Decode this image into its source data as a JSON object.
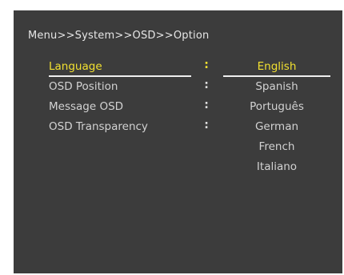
{
  "breadcrumb": "Menu>>System>>OSD>>Option",
  "menu_items": [
    {
      "label": "Language",
      "selected": true
    },
    {
      "label": "OSD Position",
      "selected": false
    },
    {
      "label": "Message OSD",
      "selected": false
    },
    {
      "label": "OSD Transparency",
      "selected": false
    }
  ],
  "separator": ":",
  "options": [
    {
      "label": "English",
      "selected": true
    },
    {
      "label": "Spanish",
      "selected": false
    },
    {
      "label": "Português",
      "selected": false
    },
    {
      "label": "German",
      "selected": false
    },
    {
      "label": "French",
      "selected": false
    },
    {
      "label": "Italiano",
      "selected": false
    }
  ],
  "colors": {
    "panel_background": "#3c3c3c",
    "highlight": "#f2e030",
    "text": "#d2d2d2",
    "underline": "#eeeeee"
  }
}
